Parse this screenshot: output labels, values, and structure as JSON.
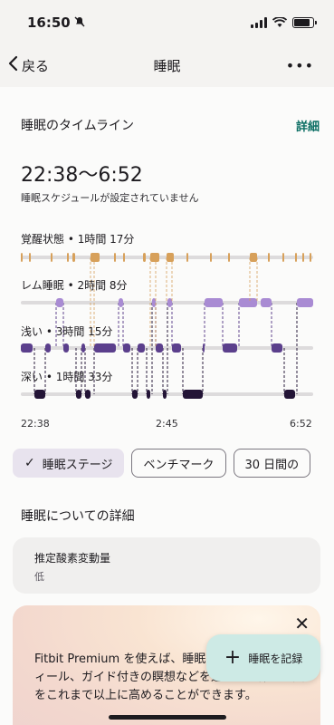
{
  "status_bar": {
    "time": "16:50"
  },
  "nav": {
    "back_label": "戻る",
    "title": "睡眠",
    "more": "•••"
  },
  "timeline": {
    "title": "睡眠のタイムライン",
    "details_link": "詳細",
    "time_range": "22:38〜6:52",
    "schedule_note": "睡眠スケジュールが設定されていません"
  },
  "stages": [
    {
      "label": "覚醒状態 • 1時間 17分",
      "color": "#d7a05a"
    },
    {
      "label": "レム睡眠 • 2時間 8分",
      "color": "#a98bd3"
    },
    {
      "label": "浅い • 3時間 15分",
      "color": "#5b3f8c"
    },
    {
      "label": "深い • 1時間 33分",
      "color": "#231436"
    }
  ],
  "chart_axis": {
    "start": "22:38",
    "mid": "2:45",
    "end": "6:52"
  },
  "chips": [
    {
      "label": "睡眠ステージ",
      "selected": true
    },
    {
      "label": "ベンチマーク",
      "selected": false
    },
    {
      "label": "30 日間の",
      "selected": false
    }
  ],
  "sleep_details": {
    "title": "睡眠についての詳細",
    "oxygen_title": "推定酸素変動量",
    "oxygen_value": "低"
  },
  "premium": {
    "text": "Fitbit Premium を使えば、睡眠のデータやプロフィール、ガイド付きの瞑想などを通じて、休息の質をこれまで以上に高めることができます。"
  },
  "fab": {
    "label": "睡眠を記録"
  }
}
